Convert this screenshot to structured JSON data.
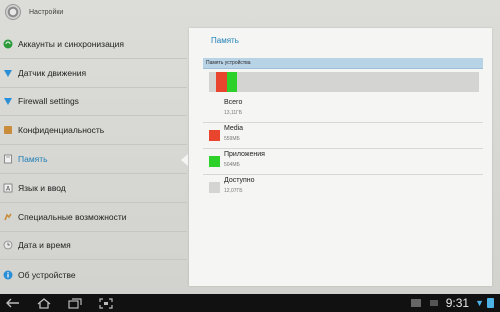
{
  "header": {
    "title": "Настройки"
  },
  "sidebar": {
    "items": [
      {
        "label": "Аккаунты и синхронизация",
        "icon": "sync-icon"
      },
      {
        "label": "Датчик движения",
        "icon": "motion-icon"
      },
      {
        "label": "Firewall settings",
        "icon": "firewall-icon"
      },
      {
        "label": "Конфиденциальность",
        "icon": "privacy-icon"
      },
      {
        "label": "Память",
        "icon": "storage-icon"
      },
      {
        "label": "Язык и ввод",
        "icon": "language-icon"
      },
      {
        "label": "Специальные возможности",
        "icon": "accessibility-icon"
      },
      {
        "label": "Дата и время",
        "icon": "clock-icon"
      },
      {
        "label": "Об устройстве",
        "icon": "info-icon"
      }
    ],
    "active_index": 4
  },
  "panel": {
    "title": "Память",
    "section_label": "Память устройства",
    "usage": {
      "media_fraction": 0.042,
      "apps_fraction": 0.038,
      "free_fraction": 0.92
    },
    "stats": [
      {
        "name": "Всего",
        "value": "13,11ГБ",
        "color": ""
      },
      {
        "name": "Media",
        "value": "559МБ",
        "color": "#e8442e"
      },
      {
        "name": "Приложения",
        "value": "504МБ",
        "color": "#2dd12a"
      },
      {
        "name": "Доступно",
        "value": "12,07ГБ",
        "color": "#d4d4d2"
      }
    ]
  },
  "statusbar": {
    "clock": "9:31",
    "nav": [
      "back-icon",
      "home-icon",
      "recent-apps-icon",
      "screenshot-icon"
    ]
  },
  "colors": {
    "accent": "#1f7fb5",
    "media": "#e8442e",
    "apps": "#2dd12a",
    "free": "#d4d4d2",
    "section_bg": "#b9d3e6"
  }
}
